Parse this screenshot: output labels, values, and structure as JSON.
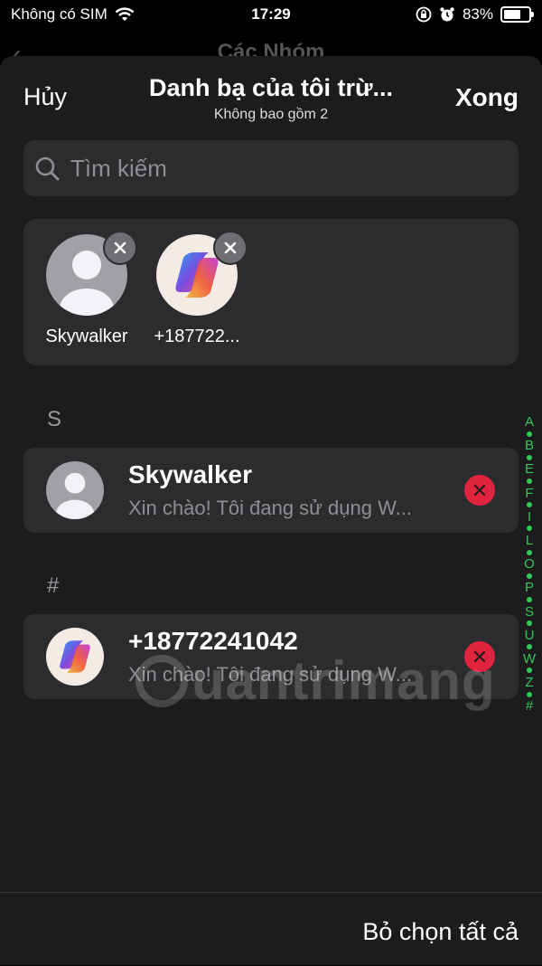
{
  "status": {
    "carrier": "Không có SIM",
    "time": "17:29",
    "battery": "83%",
    "battery_level": 0.83
  },
  "background_page": {
    "title": "Các Nhóm"
  },
  "nav": {
    "cancel": "Hủy",
    "title": "Danh bạ của tôi trừ...",
    "subtitle": "Không bao gồm 2",
    "done": "Xong"
  },
  "search": {
    "placeholder": "Tìm kiếm"
  },
  "selected": [
    {
      "name": "Skywalker",
      "avatar": "default-person-icon"
    },
    {
      "name": "+187722...",
      "avatar": "copilot-logo-icon"
    }
  ],
  "sections": [
    {
      "header": "S",
      "contact": {
        "name": "Skywalker",
        "message": "Xin chào! Tôi đang sử dụng W..."
      }
    },
    {
      "header": "#",
      "contact": {
        "name": "+18772241042",
        "message": "Xin chào! Tôi đang sử dụng W..."
      }
    }
  ],
  "index": [
    "A",
    "B",
    "E",
    "F",
    "I",
    "L",
    "O",
    "P",
    "S",
    "U",
    "W",
    "Z",
    "#"
  ],
  "footer": {
    "deselect_all": "Bỏ chọn tất cả"
  },
  "watermark": "uantrimang",
  "colors": {
    "accent": "#34c759",
    "destructive": "#e0243d",
    "sheet": "#1c1c1e",
    "cell": "#2c2c2e"
  }
}
